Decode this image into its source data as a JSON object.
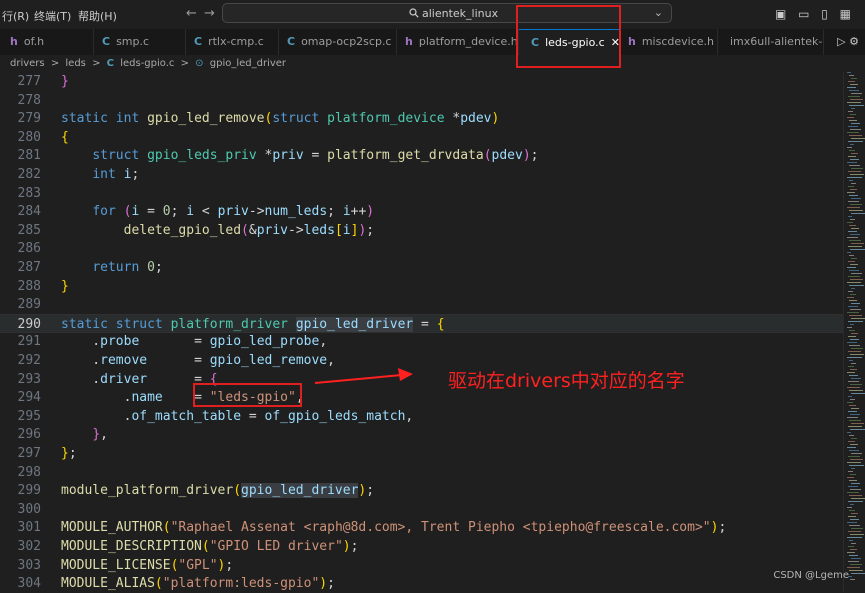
{
  "titlebar": {
    "menu": [
      "行(R)",
      "终端(T)",
      "帮助(H)"
    ],
    "back_arrow": "←",
    "forward_arrow": "→",
    "search_text": "alientek_linux",
    "search_icon": "magnifier-icon",
    "layout_icons": "▣ ▭ ▯ ▦"
  },
  "tabs": [
    {
      "label": "of.h",
      "file_icon": "h",
      "icon_color": "#a074c4"
    },
    {
      "label": "smp.c",
      "file_icon": "C",
      "icon_color": "#519aba"
    },
    {
      "label": "rtlx-cmp.c",
      "file_icon": "C",
      "icon_color": "#519aba"
    },
    {
      "label": "omap-ocp2scp.c",
      "file_icon": "C",
      "icon_color": "#519aba"
    },
    {
      "label": "platform_device.h",
      "file_icon": "h",
      "icon_color": "#a074c4"
    },
    {
      "label": "leds-gpio.c",
      "file_icon": "C",
      "icon_color": "#519aba",
      "close": "✕"
    },
    {
      "label": "miscdevice.h",
      "file_icon": "h",
      "icon_color": "#a074c4"
    },
    {
      "label": "imx6ull-alientek-e",
      "file_icon": "",
      "icon_color": "#cccccc"
    }
  ],
  "tab_actions": "▷ ⚙",
  "breadcrumb": {
    "parts": [
      "drivers",
      ">",
      "leds",
      ">",
      "C",
      "leds-gpio.c",
      ">",
      "⊙",
      "gpio_led_driver"
    ]
  },
  "code_lines": [
    {
      "n": "277",
      "tokens": [
        [
          "brk2",
          "}"
        ]
      ]
    },
    {
      "n": "278",
      "tokens": []
    },
    {
      "n": "279",
      "tokens": [
        [
          "kw",
          "static "
        ],
        [
          "kw",
          "int "
        ],
        [
          "fn",
          "gpio_led_remove"
        ],
        [
          "brk",
          "("
        ],
        [
          "kw",
          "struct "
        ],
        [
          "ty",
          "platform_device "
        ],
        [
          "op",
          "*"
        ],
        [
          "var",
          "pdev"
        ],
        [
          "brk",
          ")"
        ]
      ]
    },
    {
      "n": "280",
      "tokens": [
        [
          "brk",
          "{"
        ]
      ]
    },
    {
      "n": "281",
      "tokens": [
        [
          "op",
          "    "
        ],
        [
          "kw",
          "struct "
        ],
        [
          "ty",
          "gpio_leds_priv "
        ],
        [
          "op",
          "*"
        ],
        [
          "var",
          "priv"
        ],
        [
          "op",
          " = "
        ],
        [
          "fn",
          "platform_get_drvdata"
        ],
        [
          "brk2",
          "("
        ],
        [
          "var",
          "pdev"
        ],
        [
          "brk2",
          ")"
        ],
        [
          "op",
          ";"
        ]
      ]
    },
    {
      "n": "282",
      "tokens": [
        [
          "op",
          "    "
        ],
        [
          "kw",
          "int "
        ],
        [
          "var",
          "i"
        ],
        [
          "op",
          ";"
        ]
      ]
    },
    {
      "n": "283",
      "tokens": []
    },
    {
      "n": "284",
      "tokens": [
        [
          "op",
          "    "
        ],
        [
          "kw",
          "for "
        ],
        [
          "brk2",
          "("
        ],
        [
          "var",
          "i"
        ],
        [
          "op",
          " = "
        ],
        [
          "num",
          "0"
        ],
        [
          "op",
          "; "
        ],
        [
          "var",
          "i"
        ],
        [
          "op",
          " < "
        ],
        [
          "var",
          "priv"
        ],
        [
          "op",
          "->"
        ],
        [
          "var",
          "num_leds"
        ],
        [
          "op",
          "; "
        ],
        [
          "var",
          "i"
        ],
        [
          "op",
          "++"
        ],
        [
          "brk2",
          ")"
        ]
      ]
    },
    {
      "n": "285",
      "tokens": [
        [
          "op",
          "        "
        ],
        [
          "fn",
          "delete_gpio_led"
        ],
        [
          "brk2",
          "("
        ],
        [
          "op",
          "&"
        ],
        [
          "var",
          "priv"
        ],
        [
          "op",
          "->"
        ],
        [
          "var",
          "leds"
        ],
        [
          "brk",
          "["
        ],
        [
          "var",
          "i"
        ],
        [
          "brk",
          "]"
        ],
        [
          "brk2",
          ")"
        ],
        [
          "op",
          ";"
        ]
      ]
    },
    {
      "n": "286",
      "tokens": []
    },
    {
      "n": "287",
      "tokens": [
        [
          "op",
          "    "
        ],
        [
          "kw",
          "return "
        ],
        [
          "num",
          "0"
        ],
        [
          "op",
          ";"
        ]
      ]
    },
    {
      "n": "288",
      "tokens": [
        [
          "brk",
          "}"
        ]
      ]
    },
    {
      "n": "289",
      "tokens": []
    },
    {
      "n": "290",
      "tokens": [
        [
          "kw",
          "static "
        ],
        [
          "kw",
          "struct "
        ],
        [
          "ty",
          "platform_driver "
        ],
        [
          "var wordhl",
          "gpio_led_driver"
        ],
        [
          "op",
          " = "
        ],
        [
          "brk",
          "{"
        ]
      ],
      "highlight": true
    },
    {
      "n": "291",
      "tokens": [
        [
          "op",
          "    ."
        ],
        [
          "var",
          "probe"
        ],
        [
          "op",
          "       = "
        ],
        [
          "var",
          "gpio_led_probe"
        ],
        [
          "op",
          ","
        ]
      ]
    },
    {
      "n": "292",
      "tokens": [
        [
          "op",
          "    ."
        ],
        [
          "var",
          "remove"
        ],
        [
          "op",
          "      = "
        ],
        [
          "var",
          "gpio_led_remove"
        ],
        [
          "op",
          ","
        ]
      ]
    },
    {
      "n": "293",
      "tokens": [
        [
          "op",
          "    ."
        ],
        [
          "var",
          "driver"
        ],
        [
          "op",
          "      = "
        ],
        [
          "brk2",
          "{"
        ]
      ]
    },
    {
      "n": "294",
      "tokens": [
        [
          "op",
          "        ."
        ],
        [
          "var",
          "name"
        ],
        [
          "op",
          "    = "
        ],
        [
          "str",
          "\"leds-gpio\""
        ],
        [
          "op",
          ","
        ]
      ]
    },
    {
      "n": "295",
      "tokens": [
        [
          "op",
          "        ."
        ],
        [
          "var",
          "of_match_table"
        ],
        [
          "op",
          " = "
        ],
        [
          "var",
          "of_gpio_leds_match"
        ],
        [
          "op",
          ","
        ]
      ]
    },
    {
      "n": "296",
      "tokens": [
        [
          "op",
          "    "
        ],
        [
          "brk2",
          "}"
        ],
        [
          "op",
          ","
        ]
      ]
    },
    {
      "n": "297",
      "tokens": [
        [
          "brk",
          "}"
        ],
        [
          "op",
          ";"
        ]
      ]
    },
    {
      "n": "298",
      "tokens": []
    },
    {
      "n": "299",
      "tokens": [
        [
          "fn",
          "module_platform_driver"
        ],
        [
          "brk",
          "("
        ],
        [
          "var wordhl",
          "gpio_led_driver"
        ],
        [
          "brk",
          ")"
        ],
        [
          "op",
          ";"
        ]
      ]
    },
    {
      "n": "300",
      "tokens": []
    },
    {
      "n": "301",
      "tokens": [
        [
          "fn",
          "MODULE_AUTHOR"
        ],
        [
          "brk",
          "("
        ],
        [
          "str",
          "\"Raphael Assenat <raph@8d.com>, Trent Piepho <tpiepho@freescale.com>\""
        ],
        [
          "brk",
          ")"
        ],
        [
          "op",
          ";"
        ]
      ]
    },
    {
      "n": "302",
      "tokens": [
        [
          "fn",
          "MODULE_DESCRIPTION"
        ],
        [
          "brk",
          "("
        ],
        [
          "str",
          "\"GPIO LED driver\""
        ],
        [
          "brk",
          ")"
        ],
        [
          "op",
          ";"
        ]
      ]
    },
    {
      "n": "303",
      "tokens": [
        [
          "fn",
          "MODULE_LICENSE"
        ],
        [
          "brk",
          "("
        ],
        [
          "str",
          "\"GPL\""
        ],
        [
          "brk",
          ")"
        ],
        [
          "op",
          ";"
        ]
      ]
    },
    {
      "n": "304",
      "tokens": [
        [
          "fn",
          "MODULE_ALIAS"
        ],
        [
          "brk",
          "("
        ],
        [
          "str",
          "\"platform:leds-gpio\""
        ],
        [
          "brk",
          ")"
        ],
        [
          "op",
          ";"
        ]
      ]
    }
  ],
  "annotation": {
    "text": "驱动在drivers中对应的名字",
    "color": "#ff2020"
  },
  "watermark": "CSDN @Lgeme"
}
